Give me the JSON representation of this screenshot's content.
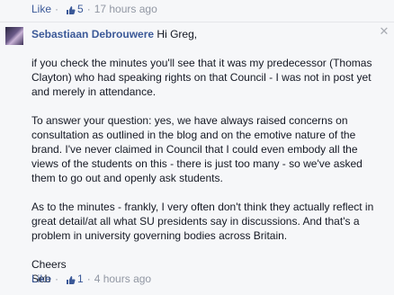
{
  "top_meta": {
    "like_label": "Like",
    "like_count": "5",
    "time": "17 hours ago"
  },
  "comment": {
    "author": "Sebastiaan Debrouwere",
    "greeting": "Hi Greg,",
    "paragraphs": [
      "if you check the minutes you'll see that it was my predecessor (Thomas Clayton) who had speaking rights on that Council - I was not in post yet and merely in attendance.",
      "To answer your question: yes, we have always raised concerns on consultation as outlined in the blog and on the emotive nature of the brand. I've never claimed in Council that I could even embody all the views of the students on this - there is just too many - so we've asked them to go out and openly ask students.",
      "As to the minutes - frankly, I very often don't think they actually reflect in great detail/at all what SU presidents say in discussions. And that's a problem in university governing bodies across Britain."
    ],
    "closing": "Cheers",
    "signature": "Seb"
  },
  "bottom_meta": {
    "like_label": "Like",
    "like_count": "1",
    "time": "4 hours ago"
  },
  "icons": {
    "thumb": "thumbs-up-icon",
    "close": "close-icon"
  },
  "colors": {
    "link": "#3b5998",
    "meta": "#9197a3",
    "text": "#141823",
    "background": "#f6f7f9"
  }
}
